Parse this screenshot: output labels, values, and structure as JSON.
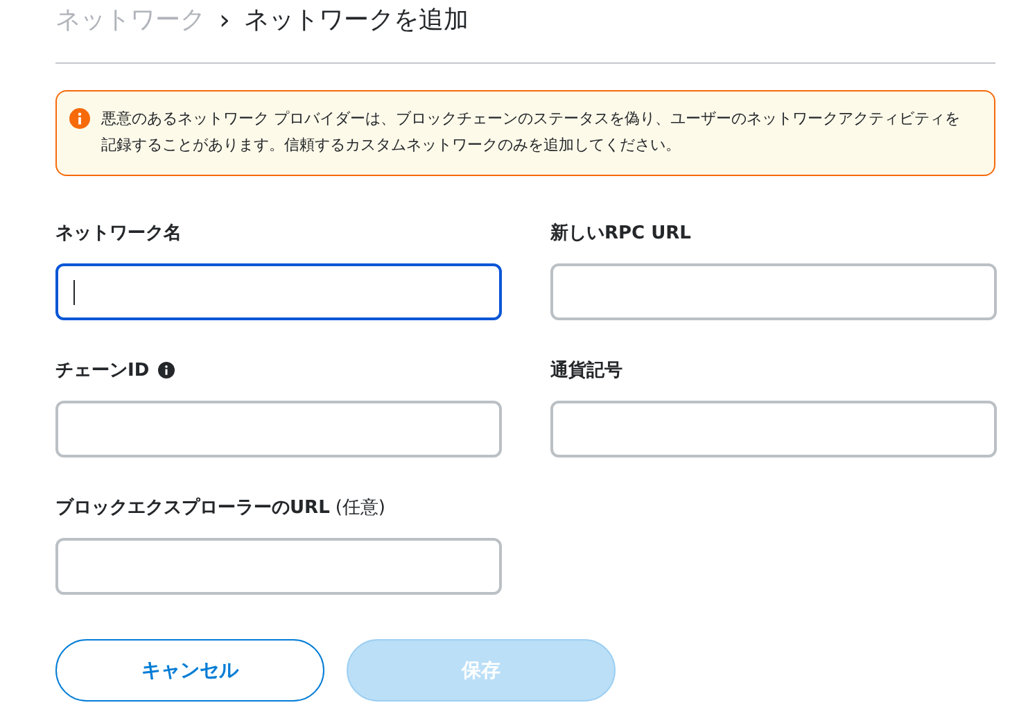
{
  "breadcrumb": {
    "parent": "ネットワーク",
    "separator": "›",
    "current": "ネットワークを追加"
  },
  "warning": {
    "text": "悪意のあるネットワーク プロバイダーは、ブロックチェーンのステータスを偽り、ユーザーのネットワークアクティビティを記録することがあります。信頼するカスタムネットワークのみを追加してください。"
  },
  "fields": [
    {
      "label": "ネットワーク名",
      "focused": true,
      "info": false
    },
    {
      "label": "新しいRPC URL",
      "focused": false,
      "info": false
    },
    {
      "label": "チェーンID",
      "focused": false,
      "info": true
    },
    {
      "label": "通貨記号",
      "focused": false,
      "info": false
    },
    {
      "label": "ブロックエクスプローラーのURL",
      "note": "(任意)",
      "focused": false,
      "info": false
    }
  ],
  "buttons": [
    {
      "label": "キャンセル",
      "kind": "secondary",
      "disabled": false
    },
    {
      "label": "保存",
      "kind": "primary",
      "disabled": true
    }
  ]
}
